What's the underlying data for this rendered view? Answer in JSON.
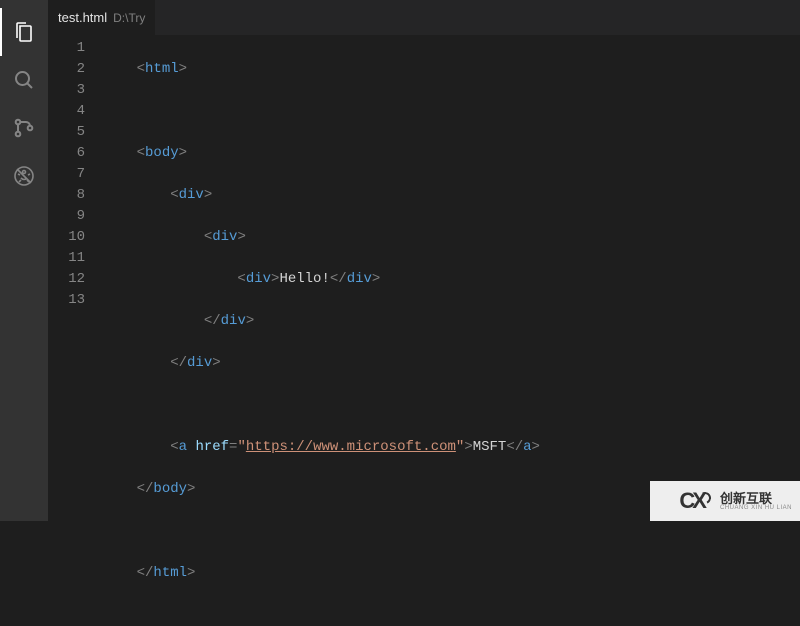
{
  "activity": {
    "items": [
      "explorer-icon",
      "search-icon",
      "source-control-icon",
      "debug-icon"
    ]
  },
  "tab": {
    "filename": "test.html",
    "filepath": "D:\\Try"
  },
  "lines": [
    "1",
    "2",
    "3",
    "4",
    "5",
    "6",
    "7",
    "8",
    "9",
    "10",
    "11",
    "12",
    "13"
  ],
  "code": {
    "l1": {
      "open": "<",
      "tag": "html",
      "close": ">"
    },
    "l3": {
      "open": "<",
      "tag": "body",
      "close": ">"
    },
    "l4": {
      "open": "<",
      "tag": "div",
      "close": ">"
    },
    "l5": {
      "open": "<",
      "tag": "div",
      "close": ">"
    },
    "l6": {
      "open": "<",
      "tag": "div",
      "mid": ">",
      "text": "Hello!",
      "open2": "</",
      "tag2": "div",
      "close": ">"
    },
    "l7": {
      "open": "</",
      "tag": "div",
      "close": ">"
    },
    "l8": {
      "open": "</",
      "tag": "div",
      "close": ">"
    },
    "l10": {
      "open": "<",
      "tag": "a",
      "sp": " ",
      "attr": "href",
      "eq": "=",
      "q1": "\"",
      "url": "https://www.microsoft.com",
      "q2": "\"",
      "mid": ">",
      "text": "MSFT",
      "open2": "</",
      "tag2": "a",
      "close": ">"
    },
    "l11": {
      "open": "</",
      "tag": "body",
      "close": ">"
    },
    "l13": {
      "open": "</",
      "tag": "html",
      "close": ">"
    }
  },
  "watermark": {
    "cn": "创新互联",
    "py": "CHUANG XIN HU LIAN"
  }
}
